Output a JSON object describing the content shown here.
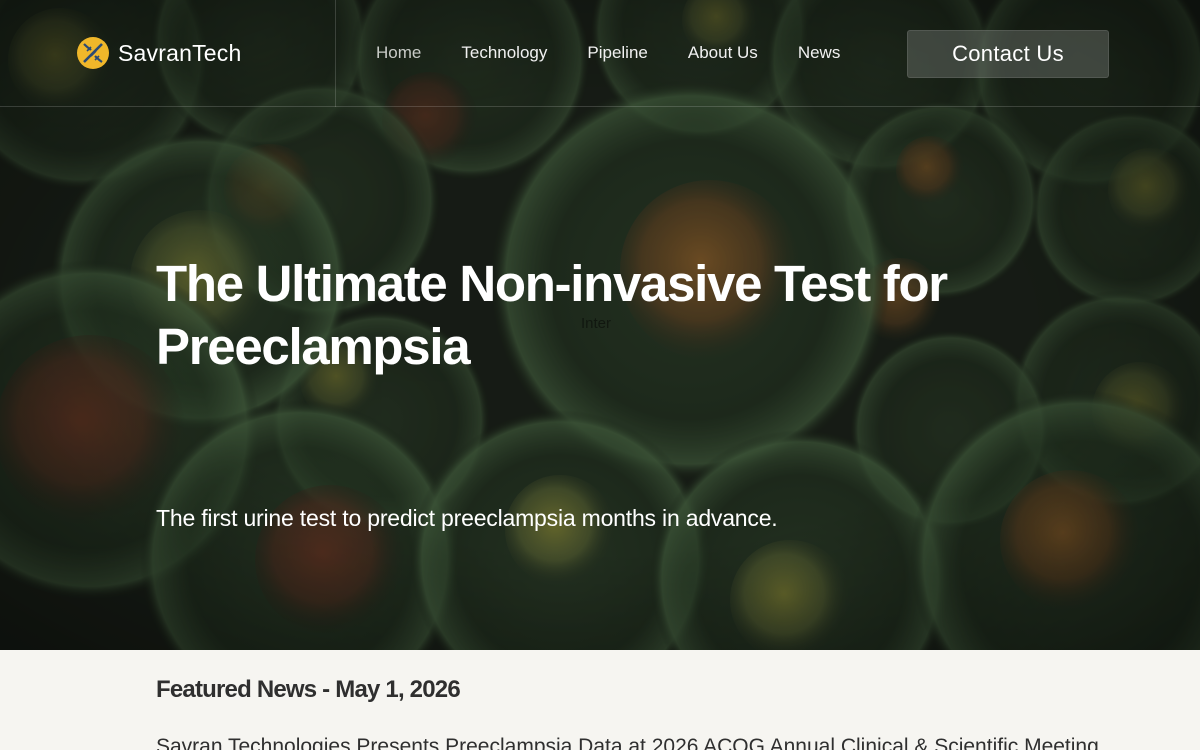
{
  "brand": {
    "name": "SavranTech",
    "logo_icon": "dna-helix-icon",
    "logo_colors": [
      "#f0b72a",
      "#2c4a73"
    ]
  },
  "nav": {
    "items": [
      {
        "label": "Home",
        "active": true
      },
      {
        "label": "Technology",
        "active": false
      },
      {
        "label": "Pipeline",
        "active": false
      },
      {
        "label": "About Us",
        "active": false
      },
      {
        "label": "News",
        "active": false
      }
    ],
    "contact_label": "Contact Us"
  },
  "hero": {
    "title": "The Ultimate Non-invasive Test for Preeclampsia",
    "ghost_label": "Inter",
    "subtitle": "The first urine test to predict preeclampsia months in advance.",
    "background": "microscopic-cells-image"
  },
  "news": {
    "heading": "Featured News - May 1, 2026",
    "headline": "Savran Technologies Presents Preeclampsia Data at 2026 ACOG Annual Clinical & Scientific Meeting"
  },
  "colors": {
    "hero_base": "#1a2019",
    "cell_green": "#3d5a3a",
    "cell_nucleus": "#8a5a2a",
    "news_background": "#f6f5f1",
    "text_dark": "#2f2f2f"
  }
}
